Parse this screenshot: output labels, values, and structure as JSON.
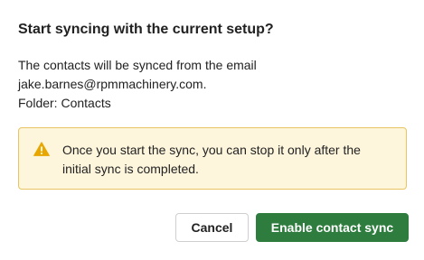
{
  "dialog": {
    "title": "Start syncing with the current setup?",
    "description_lines": [
      "The contacts will be synced from the email",
      "jake.barnes@rpmmachinery.com.",
      "Folder: Contacts"
    ],
    "warning": {
      "icon": "warning-triangle-icon",
      "lines": [
        "Once you start the sync, you can stop it only after the",
        "initial sync is completed."
      ],
      "background_color": "#fdf5dc",
      "border_color": "#e8c462",
      "icon_color": "#e8a700"
    },
    "buttons": {
      "cancel_label": "Cancel",
      "confirm_label": "Enable contact sync",
      "confirm_color": "#2e7d3e"
    }
  }
}
